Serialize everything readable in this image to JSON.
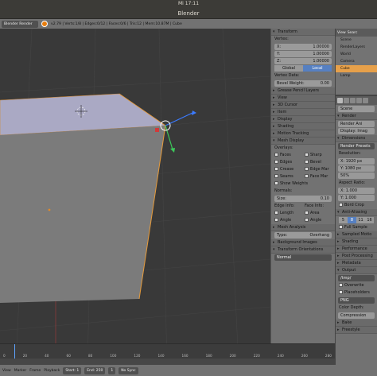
{
  "os": {
    "clock": "Mi 17:11"
  },
  "window": {
    "title": "Blender"
  },
  "info": {
    "engine": "Blender Render",
    "stats": "v2.79 | Verts:1/8 | Edges:0/12 | Faces:0/6 | Tris:12 | Mem:10.87M | Cube"
  },
  "npanel": {
    "transform": "Transform",
    "vertex": "Vertex:",
    "x_label": "X:",
    "x_val": "1.00000",
    "y_label": "Y:",
    "y_val": "1.00000",
    "z_label": "Z:",
    "z_val": "1.00000",
    "global": "Global",
    "local": "Local",
    "vertex_data": "Vertex Data:",
    "bevel_weight": "Bevel Weight:",
    "bevel_val": "0.00",
    "grease": "Grease Pencil Layers",
    "view": "View",
    "cursor": "3D Cursor",
    "item": "Item",
    "display": "Display",
    "shading": "Shading",
    "motion": "Motion Tracking",
    "mesh_display": "Mesh Display",
    "overlays": "Overlays:",
    "ov": [
      "Faces",
      "Sharp",
      "Edges",
      "Bevel",
      "Crease",
      "Edge Mar",
      "Seams",
      "Face Mar"
    ],
    "show_weights": "Show Weights",
    "normals": "Normals:",
    "size_label": "Size:",
    "size_val": "0.10",
    "edge_info": "Edge Info:",
    "face_info": "Face Info:",
    "info_rows": [
      "Length",
      "Area",
      "Angle",
      "Angle"
    ],
    "mesh_analysis": "Mesh Analysis",
    "type_label": "Type:",
    "type_val": "Overhang",
    "bg_images": "Background Images",
    "orientations": "Transform Orientations",
    "orient_val": "Normal"
  },
  "outliner": {
    "view_label": "View",
    "search_label": "Searc",
    "items": [
      "Scene",
      "RenderLayers",
      "World",
      "Camera",
      "Cube",
      "Lamp"
    ]
  },
  "props": {
    "scene_label": "Scene",
    "render": "Render",
    "render_btn": "Render",
    "anim_btn": "Ani",
    "display_label": "Display:",
    "display_val": "Imag",
    "dimensions": "Dimensions",
    "presets": "Render Presets",
    "resolution": "Resolution:",
    "res_x": "X:",
    "res_x_val": "1920 px",
    "res_y": "Y:",
    "res_y_val": "1080 px",
    "res_pct": "50%",
    "aspect": "Aspect Ratio:",
    "asp_x": "X:",
    "asp_x_val": "1.000",
    "asp_y": "Y:",
    "asp_y_val": "1.000",
    "border": "Bord",
    "crop": "Crop",
    "aa": "Anti-Aliasing",
    "aa_vals": [
      "5",
      "8",
      "11",
      "16"
    ],
    "full_sample": "Full Sample",
    "sampled_motion": "Sampled Motio",
    "shading": "Shading",
    "performance": "Performance",
    "post": "Post Processing",
    "metadata": "Metadata",
    "output": "Output",
    "tmp": "/tmp/",
    "overwrite": "Overwrite",
    "placeholders": "Placeholders",
    "png": "PNG",
    "color_depth": "Color Depth:",
    "compression": "Compression",
    "bake": "Bake",
    "freestyle": "Freestyle"
  },
  "timeline": {
    "ticks": [
      "0",
      "20",
      "40",
      "60",
      "80",
      "100",
      "120",
      "140",
      "160",
      "180",
      "200",
      "220",
      "240",
      "260",
      "280"
    ]
  },
  "bottom": {
    "view": "View",
    "marker": "Marker",
    "frame": "Frame",
    "playback": "Playback",
    "start_label": "Start:",
    "start": "1",
    "end_label": "End:",
    "end": "250",
    "current": "1",
    "sync": "No Sync"
  }
}
